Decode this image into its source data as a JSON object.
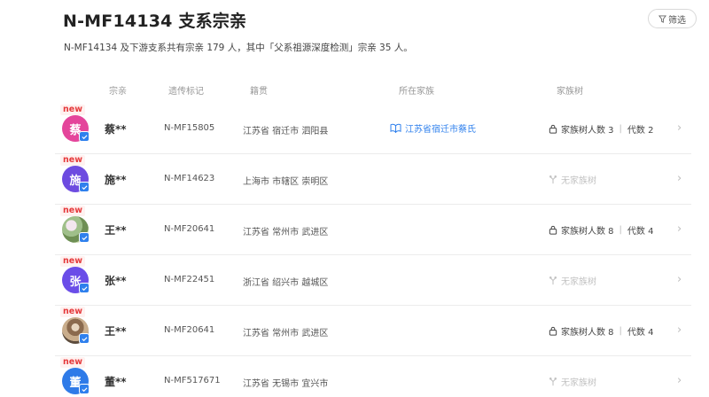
{
  "header": {
    "title": "N-MF14134 支系宗亲",
    "filter_label": "筛选",
    "description": "N-MF14134 及下游支系共有宗亲 179 人，其中「父系祖源深度检测」宗亲 35 人。"
  },
  "columns": {
    "relative": "宗亲",
    "genetic_marker": "遗传标记",
    "origin": "籍贯",
    "clan": "所在家族",
    "family_tree": "家族树"
  },
  "new_label": "new",
  "tree_labels": {
    "count_prefix": "家族树人数",
    "gen_prefix": "代数",
    "separator": "|",
    "no_tree": "无家族树"
  },
  "rows": [
    {
      "avatar_text": "蔡",
      "avatar_color": "#e4459b",
      "name": "蔡**",
      "marker": "N-MF15805",
      "origin": "江苏省 宿迁市 泗阳县",
      "clan": "江苏省宿迁市蔡氏",
      "tree_count": "家族树人数 3",
      "tree_gen": "代数 2",
      "has_tree": true
    },
    {
      "avatar_text": "施",
      "avatar_color": "#6d4be0",
      "name": "施**",
      "marker": "N-MF14623",
      "origin": "上海市 市辖区 崇明区",
      "clan": "",
      "tree_none": "无家族树",
      "has_tree": false
    },
    {
      "avatar_text": "",
      "avatar_color": "photo",
      "name": "王**",
      "marker": "N-MF20641",
      "origin": "江苏省 常州市 武进区",
      "clan": "",
      "tree_count": "家族树人数 8",
      "tree_gen": "代数 4",
      "has_tree": true
    },
    {
      "avatar_text": "张",
      "avatar_color": "#6a4de8",
      "name": "张**",
      "marker": "N-MF22451",
      "origin": "浙江省 绍兴市 越城区",
      "clan": "",
      "tree_none": "无家族树",
      "has_tree": false
    },
    {
      "avatar_text": "",
      "avatar_color": "photo",
      "name": "王**",
      "marker": "N-MF20641",
      "origin": "江苏省 常州市 武进区",
      "clan": "",
      "tree_count": "家族树人数 8",
      "tree_gen": "代数 4",
      "has_tree": true
    },
    {
      "avatar_text": "董",
      "avatar_color": "#2f7be8",
      "name": "董**",
      "marker": "N-MF517671",
      "origin": "江苏省 无锡市 宜兴市",
      "clan": "",
      "tree_none": "无家族树",
      "has_tree": false
    }
  ]
}
